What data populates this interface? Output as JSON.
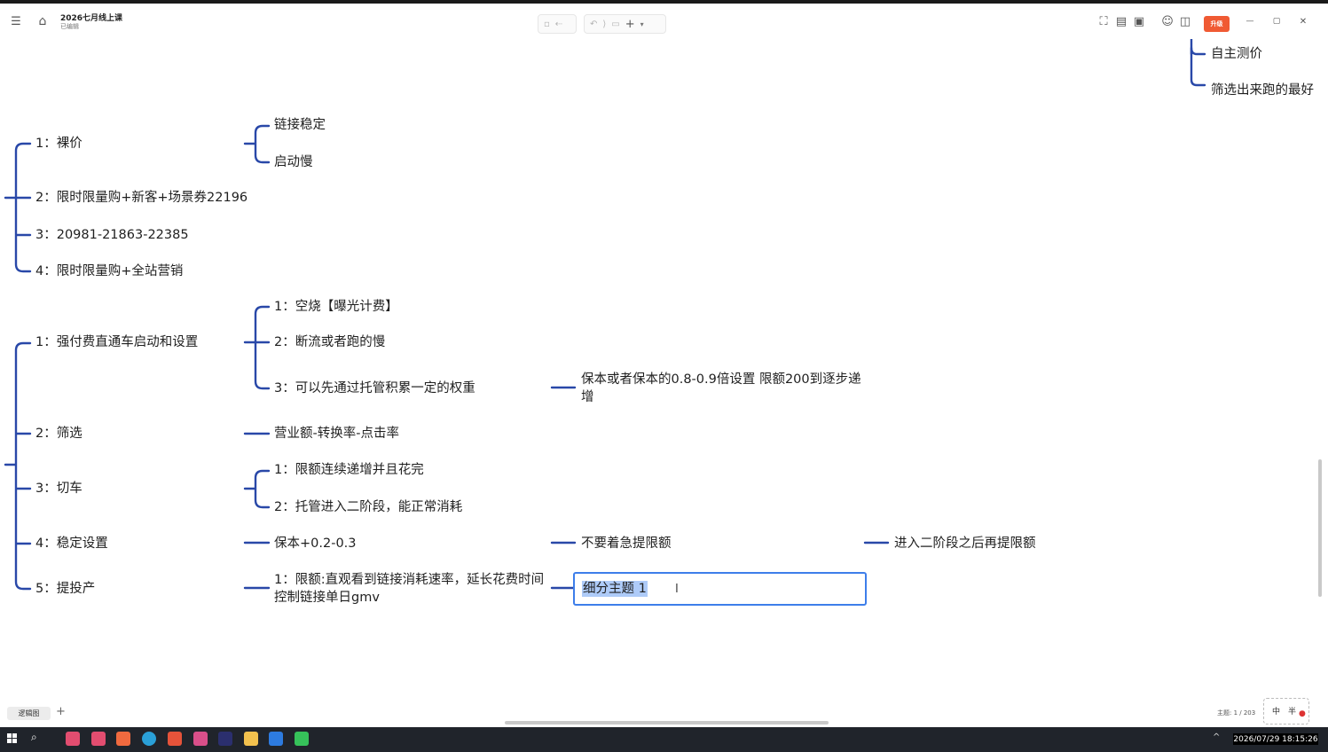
{
  "window": {
    "title": "2026七月线上课",
    "status": "已编辑",
    "upgrade_label": "升级",
    "controls": {
      "minimize": "—",
      "restore": "▢",
      "close": "✕"
    }
  },
  "toolbar": {
    "undo_icon": "undo-icon",
    "redo_icon": "redo-icon",
    "insert_label": "+"
  },
  "mindmap": {
    "top_branch": {
      "items": [
        "自主测价",
        "筛选出来跑的最好"
      ]
    },
    "group_a": {
      "items": [
        {
          "label": "1：裸价",
          "children": [
            "链接稳定",
            "启动慢"
          ]
        },
        {
          "label": "2：限时限量购+新客+场景券22196"
        },
        {
          "label": "3：20981-21863-22385"
        },
        {
          "label": "4：限时限量购+全站营销"
        }
      ]
    },
    "group_b": {
      "items": [
        {
          "label": "1：强付费直通车启动和设置",
          "children": [
            "1：空烧【曝光计费】",
            "2：断流或者跑的慢",
            "3：可以先通过托管积累一定的权重"
          ],
          "grandchild": "保本或者保本的0.8-0.9倍设置  限额200到逐步递增"
        },
        {
          "label": "2：筛选",
          "children": [
            "营业额-转换率-点击率"
          ]
        },
        {
          "label": "3：切车",
          "children": [
            "1：限额连续递增并且花完",
            "2：托管进入二阶段，能正常消耗"
          ]
        },
        {
          "label": "4：稳定设置",
          "children": [
            "保本+0.2-0.3"
          ],
          "chain": [
            "不要着急提限额",
            "进入二阶段之后再提限额"
          ]
        },
        {
          "label": "5：提投产",
          "children": [
            "1：限额:直观看到链接消耗速率，延长花费时间控制链接单日gmv"
          ],
          "editing": "细分主题 1"
        }
      ]
    }
  },
  "statusbar": {
    "sheet_tab": "逻辑图",
    "add_sheet": "+",
    "topic_count": "主题: 1 / 203"
  },
  "ime": {
    "lang": "中",
    "half": "半"
  },
  "taskbar": {
    "clock": "2026/07/29 18:15:26",
    "tray_arrow": "^"
  },
  "colors": {
    "line": "#2948a8",
    "accent": "#f05a33",
    "selection": "#3d7eea"
  }
}
